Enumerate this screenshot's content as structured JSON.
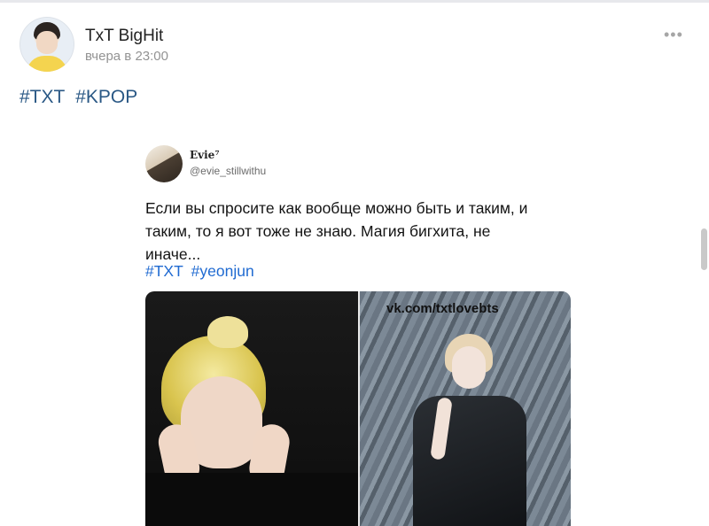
{
  "post": {
    "author": "TxT BigHit",
    "time": "вчера в 23:00",
    "more_label": "•••",
    "hashtags": [
      "#TXT",
      "#KPOP"
    ]
  },
  "tweet": {
    "name": "Evie⁷",
    "handle": "@evie_stillwithu",
    "text_lines": [
      "Если вы спросите как вообще можно быть и таким, и",
      "таким, то я вот тоже не знаю. Магия бигхита, не",
      "иначе..."
    ],
    "hashtags": [
      "#TXT",
      "#yeonjun"
    ]
  },
  "photos": {
    "watermark": "vk.com/txtlovebts"
  },
  "colors": {
    "link_blue": "#2a5885",
    "tweet_link_blue": "#1f6ad1",
    "muted_gray": "#939393"
  }
}
